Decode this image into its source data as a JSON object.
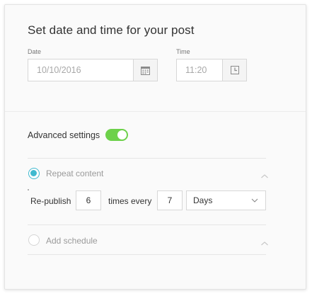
{
  "dialog": {
    "title": "Set date and time for your post"
  },
  "date": {
    "label": "Date",
    "value": "10/10/2016",
    "button_icon": "calendar-icon"
  },
  "time": {
    "label": "Time",
    "value": "11:20",
    "button_icon": "clock-icon"
  },
  "advanced": {
    "label": "Advanced settings",
    "enabled": true,
    "toggle_color": "#6dd14a"
  },
  "repeat": {
    "label": "Repeat content",
    "selected": true,
    "radio_color": "#3fb9cf",
    "republish_label": "Re-publish",
    "times_value": "6",
    "times_every_label": "times every",
    "interval_value": "7",
    "unit_selected": "Days"
  },
  "schedule": {
    "label": "Add schedule",
    "selected": false
  }
}
